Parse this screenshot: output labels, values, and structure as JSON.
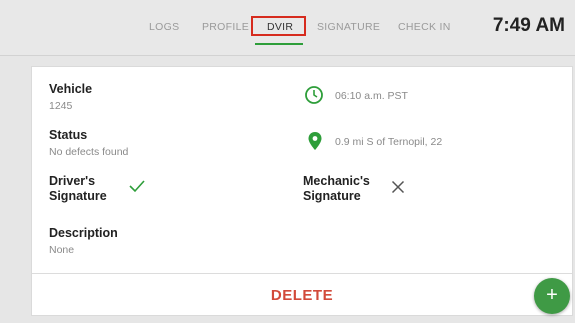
{
  "nav": {
    "tabs": [
      {
        "label": "LOGS"
      },
      {
        "label": "PROFILE"
      },
      {
        "label": "DVIR"
      },
      {
        "label": "SIGNATURE"
      },
      {
        "label": "CHECK IN"
      }
    ],
    "active_tab": "DVIR",
    "time": "7:49 AM"
  },
  "report": {
    "vehicle_label": "Vehicle",
    "vehicle_value": "1245",
    "status_label": "Status",
    "status_value": "No defects found",
    "driver_signature_label": "Driver's Signature",
    "driver_signature_line1": "Driver's",
    "driver_signature_line2": "Signature",
    "mechanic_signature_line1": "Mechanic's",
    "mechanic_signature_line2": "Signature",
    "description_label": "Description",
    "description_value": "None",
    "time_value": "06:10 a.m. PST",
    "location_value": "0.9 mi S of Ternopil, 22"
  },
  "actions": {
    "delete_label": "DELETE",
    "fab_label": "+"
  },
  "colors": {
    "accent_green": "#2e9e3a",
    "highlight_red": "#d62b1e",
    "delete_red": "#d24a3a"
  },
  "icons": {
    "time": "clock-icon",
    "location": "location-pin-icon",
    "driver_signed": "checkmark-icon",
    "mechanic_unsigned": "close-icon"
  }
}
